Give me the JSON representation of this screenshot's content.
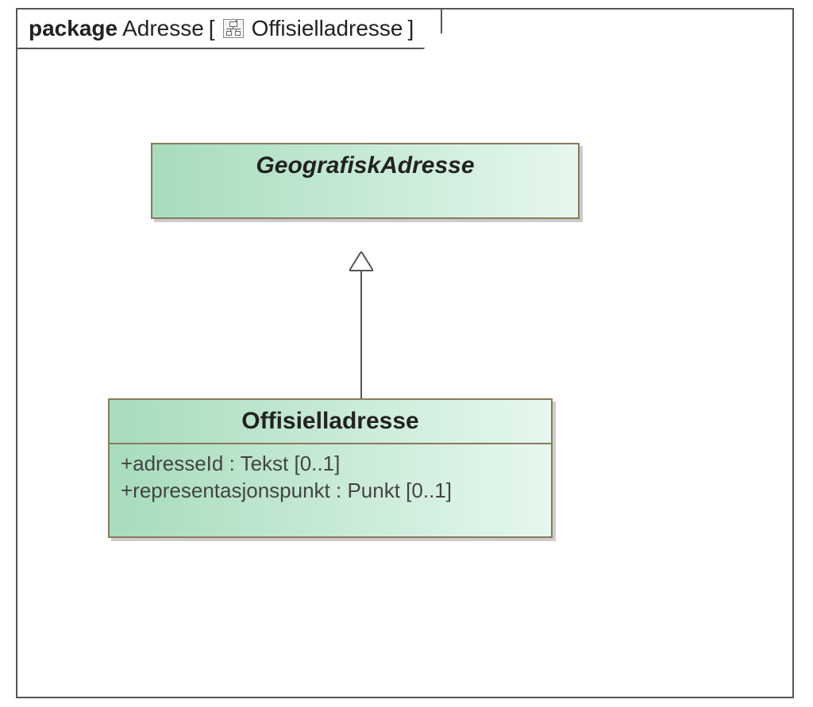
{
  "package": {
    "keyword": "package",
    "name": "Adresse",
    "bracket_open": "[",
    "bracket_close": "]",
    "diagram_name": "Offisielladresse"
  },
  "classes": {
    "geografisk_adresse": {
      "name": "GeografiskAdresse",
      "abstract": true
    },
    "offisiell_adresse": {
      "name": "Offisielladresse",
      "attributes": [
        "+adresseId : Tekst [0..1]",
        "+representasjonspunkt : Punkt [0..1]"
      ]
    }
  },
  "relationships": [
    {
      "type": "generalization",
      "from": "offisiell_adresse",
      "to": "geografisk_adresse"
    }
  ]
}
